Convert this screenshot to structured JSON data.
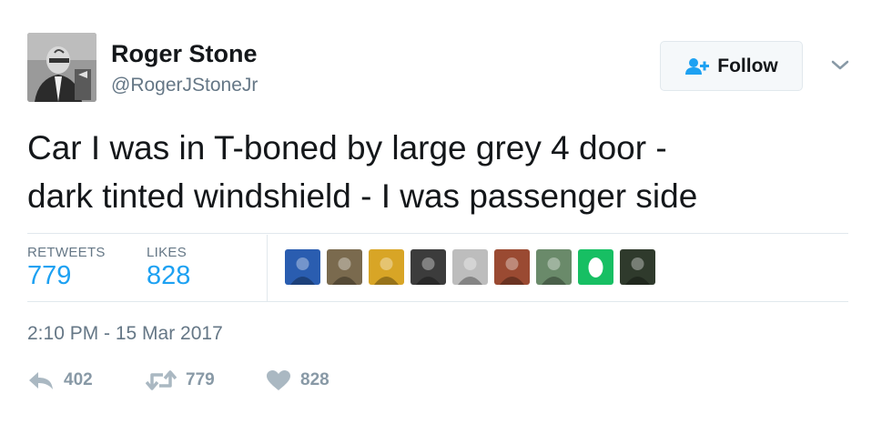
{
  "user": {
    "name": "Roger Stone",
    "handle": "@RogerJStoneJr"
  },
  "follow_button": {
    "label": "Follow"
  },
  "tweet": {
    "text_line1": "Car I was in T-boned by large grey 4 door -",
    "text_line2": "dark tinted windshield - I was passenger side"
  },
  "stats": {
    "retweets_label": "RETWEETS",
    "retweets_value": "779",
    "likes_label": "LIKES",
    "likes_value": "828"
  },
  "liker_avatars": [
    {
      "name": "liker-avatar-1",
      "color": "#2a5db0"
    },
    {
      "name": "liker-avatar-2",
      "color": "#7a6a4e"
    },
    {
      "name": "liker-avatar-3",
      "color": "#d8a526"
    },
    {
      "name": "liker-avatar-4",
      "color": "#3c3c3c"
    },
    {
      "name": "liker-avatar-5",
      "color": "#bdbdbd"
    },
    {
      "name": "liker-avatar-6",
      "color": "#9a4a32"
    },
    {
      "name": "liker-avatar-7",
      "color": "#6a8a6a"
    },
    {
      "name": "liker-avatar-8",
      "color": "#17bf63"
    },
    {
      "name": "liker-avatar-9",
      "color": "#2f3a2c"
    }
  ],
  "timestamp": "2:10 PM - 15 Mar 2017",
  "actions": {
    "reply_count": "402",
    "retweet_count": "779",
    "like_count": "828"
  },
  "colors": {
    "accent": "#1da1f2",
    "text": "#14171a",
    "secondary": "#657786",
    "icon": "#aab8c2"
  }
}
